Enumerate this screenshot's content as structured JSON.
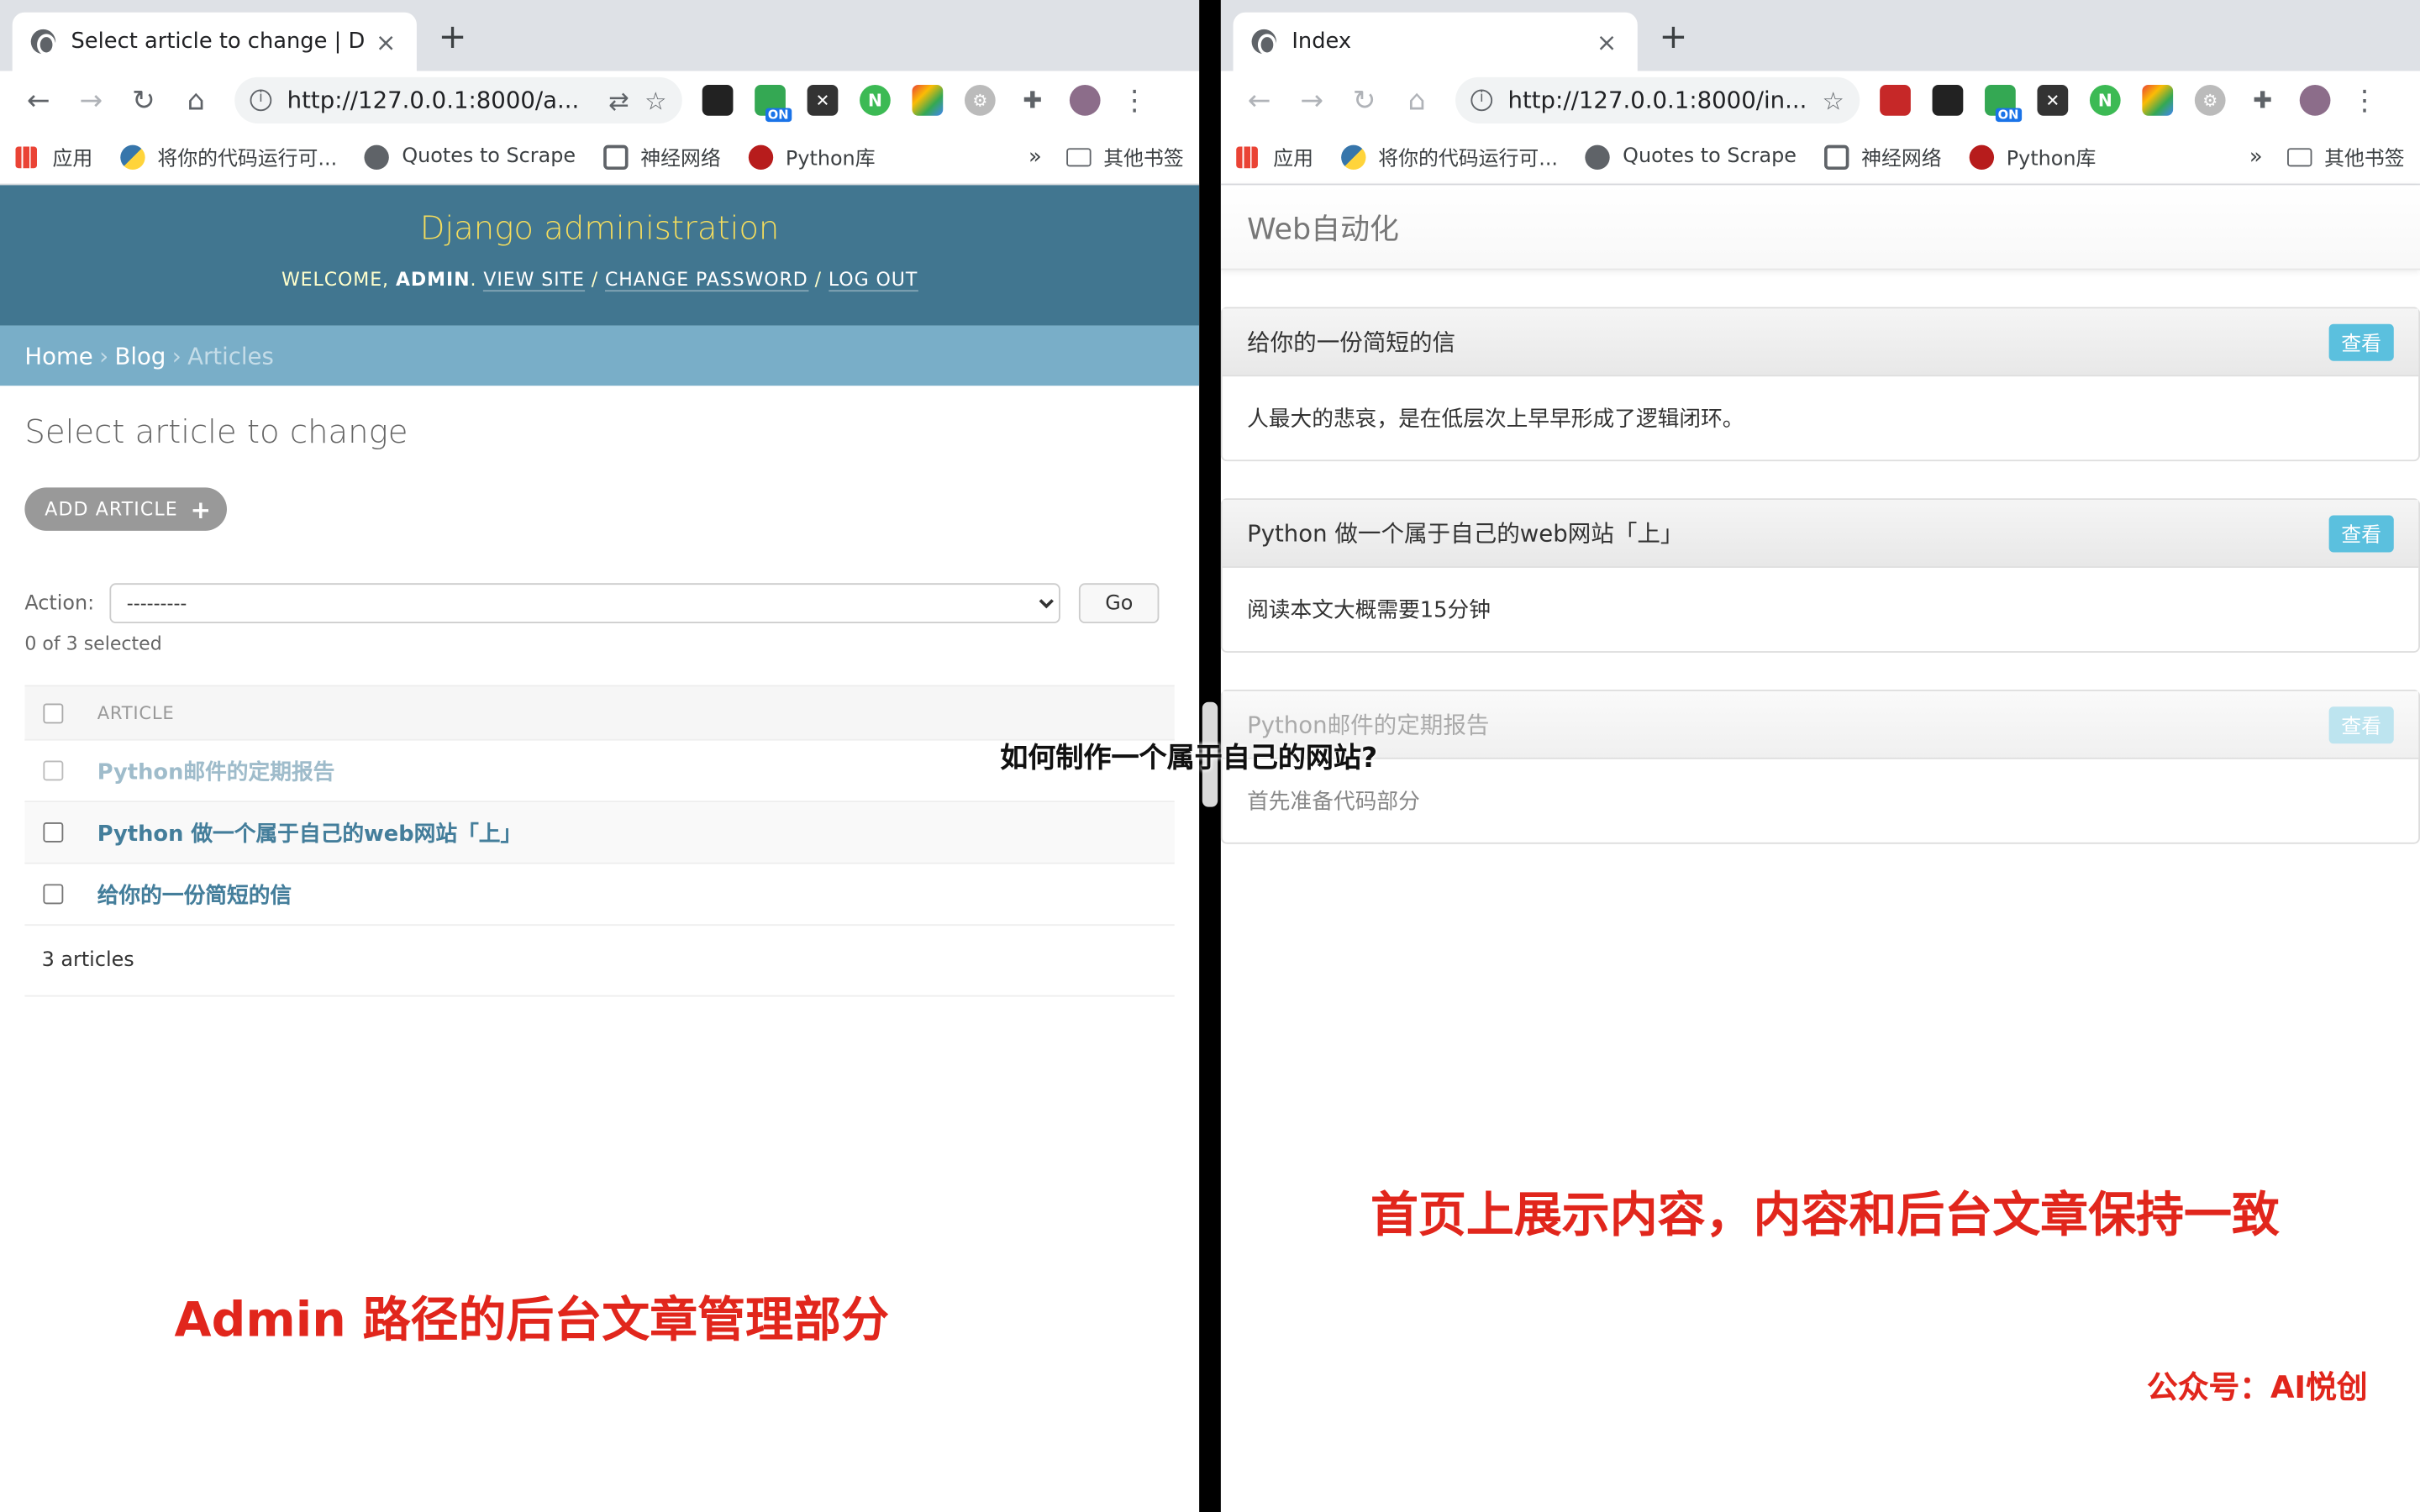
{
  "left": {
    "tab": {
      "title": "Select article to change | Django site admin",
      "close": "×"
    },
    "newtab": "+",
    "url": "http://127.0.0.1:8000/a...",
    "bookmarks": [
      "应用",
      "将你的代码运行可...",
      "Quotes to Scrape",
      "神经网络",
      "Python库"
    ],
    "bookmarks_more": "»",
    "other_bookmarks": "其他书签",
    "ext_badge": "ON",
    "admin": {
      "brand": "Django administration",
      "welcome": "WELCOME,",
      "user": "ADMIN",
      "view_site": "VIEW SITE",
      "change_password": "CHANGE PASSWORD",
      "logout": "LOG OUT",
      "breadcrumbs": [
        "Home",
        "Blog",
        "Articles"
      ],
      "heading": "Select article to change",
      "add_button": "ADD ARTICLE",
      "action_label": "Action:",
      "action_value": "---------",
      "go": "Go",
      "selected": "0 of 3 selected",
      "column": "ARTICLE",
      "rows": [
        "Python邮件的定期报告",
        "Python 做一个属于自己的web网站「上」",
        "给你的一份简短的信"
      ],
      "count": "3 articles"
    },
    "note": "Admin 路径的后台文章管理部分"
  },
  "right": {
    "tab": {
      "title": "Index",
      "close": "×"
    },
    "newtab": "+",
    "url": "http://127.0.0.1:8000/in...",
    "bookmarks": [
      "应用",
      "将你的代码运行可...",
      "Quotes to Scrape",
      "神经网络",
      "Python库"
    ],
    "bookmarks_more": "»",
    "other_bookmarks": "其他书签",
    "ext_badge": "ON",
    "index": {
      "brand": "Web自动化",
      "posts": [
        {
          "title": "给你的一份简短的信",
          "body": "人最大的悲哀，是在低层次上早早形成了逻辑闭环。",
          "button": "查看"
        },
        {
          "title": "Python 做一个属于自己的web网站「上」",
          "body": "阅读本文大概需要15分钟",
          "button": "查看"
        },
        {
          "title": "Python邮件的定期报告",
          "body": "首先准备代码部分",
          "button": "查看"
        }
      ]
    },
    "note": "首页上展示内容，内容和后台文章保持一致",
    "watermark": "公众号：AI悦创"
  },
  "caption": "如何制作一个属于自己的网站?"
}
